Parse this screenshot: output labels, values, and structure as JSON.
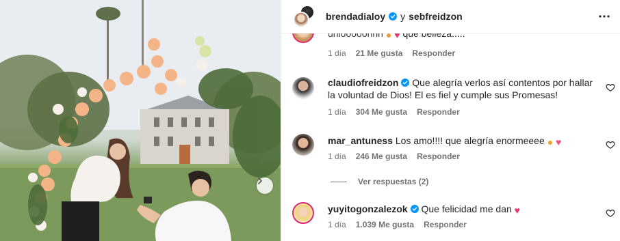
{
  "post": {
    "author": "brendadialoy",
    "conjunction": "y",
    "coauthor": "sebfreidzon"
  },
  "colors": {
    "verified_blue": "#0095f6",
    "meta_gray": "#737373",
    "text": "#262626"
  },
  "icons": {
    "more": "more-horizontal-icon",
    "verified": "verified-badge-icon",
    "like": "heart-outline-icon",
    "carousel_next": "chevron-right-icon"
  },
  "comments": [
    {
      "username": "",
      "text_fragment": "uniooooohhh",
      "text_tail": "que belleza.....",
      "time": "1 día",
      "likes": "21 Me gusta",
      "reply": "Responder"
    },
    {
      "username": "claudiofreidzon",
      "verified": true,
      "text": "Que alegría verlos así contentos por hallar la voluntad de Dios! El es fiel y cumple sus Promesas!",
      "time": "1 día",
      "likes": "304 Me gusta",
      "reply": "Responder"
    },
    {
      "username": "mar_antuness",
      "verified": false,
      "text": "Los amo!!!! que alegría enormeeee",
      "time": "1 día",
      "likes": "246 Me gusta",
      "reply": "Responder",
      "view_replies": "Ver respuestas (2)"
    },
    {
      "username": "yuyitogonzalezok",
      "verified": true,
      "text": "Que felicidad me dan",
      "time": "1 día",
      "likes": "1.039 Me gusta",
      "reply": "Responder"
    }
  ]
}
